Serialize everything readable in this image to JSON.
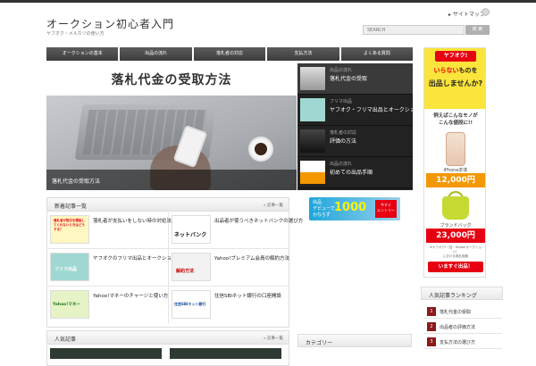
{
  "header": {
    "site_title": "オークション初心者入門",
    "site_desc": "ヤフオク・メルカリの使い方",
    "top_link": "サイトマップ",
    "rss_icon": "rss-icon",
    "search_placeholder": "SEARCH",
    "search_button": "検 索"
  },
  "nav": {
    "items": [
      "オークションの基本",
      "出品の流れ",
      "落札者の対応",
      "支払方法",
      "よくある質問"
    ]
  },
  "slider": {
    "banner_text": "落札代金の受取方法",
    "caption": "落札代金の受取方法",
    "items": [
      {
        "category": "出品の流れ",
        "title": "落札代金の受取"
      },
      {
        "category": "フリマ出品",
        "title": "ヤフオク・フリマ出品とオークションの違い"
      },
      {
        "category": "落札者の対応",
        "title": "評価の方法"
      },
      {
        "category": "出品の流れ",
        "title": "初めての出品手順"
      }
    ]
  },
  "new_articles": {
    "title": "新着記事一覧",
    "more": "» 記事一覧",
    "items": [
      {
        "title": "落札者が支払いをしない時の対処法",
        "thumb": "落札者が取引を開始してくれないときはどうする？"
      },
      {
        "title": "出品者が使うべきネットバンクの選び方",
        "thumb": "ネットバンク"
      },
      {
        "title": "ヤフオクのフリマ出品とオークションの違い",
        "thumb": "フリマ出品"
      },
      {
        "title": "Yahoo!プレミアム会員の解約方法",
        "thumb": "解約方法"
      },
      {
        "title": "Yahoo!マネーのチャージと使い方",
        "thumb": "Yahoo!マネー"
      },
      {
        "title": "住信SBIネット銀行の口座開設",
        "thumb": "住信SBIネット銀行"
      }
    ]
  },
  "popular": {
    "title": "人気記事",
    "more": "» 記事一覧"
  },
  "mini_banner": {
    "text_line1": "出品",
    "text_line2": "デビューで",
    "text_line3": "かならず",
    "big": "1000",
    "tag_line1": "今すぐ",
    "tag_line2": "エントリー"
  },
  "ad": {
    "logo": "ヤフオク!",
    "line1_red": "いらない",
    "line1_rest": "ものを",
    "line2": "出品しませんか?",
    "line3a": "例えばこんなモノが",
    "line3b": "こんな値段に!!",
    "iphone_label": "iPhone本体",
    "price1": "12,000円",
    "bag_label": "ブランドバッグ",
    "price2": "23,000円",
    "fine1": "※ヤフオク!（旧：Yahoo!オークション）",
    "fine2": "における落札価格",
    "cta": "いますぐ出品！"
  },
  "sidebar": {
    "category_title": "カテゴリー",
    "ranking_title": "人気記事ランキング",
    "ranking": [
      {
        "num": "1",
        "text": "落札代金の受取"
      },
      {
        "num": "2",
        "text": "出品者の評価方法"
      },
      {
        "num": "3",
        "text": "支払方法の選び方"
      }
    ]
  },
  "colors": {
    "nav_bg": "#4a4a4a",
    "accent_red": "#e60012",
    "ad_yellow": "#fbe43b",
    "rank_badge": "#8b1a1a"
  }
}
